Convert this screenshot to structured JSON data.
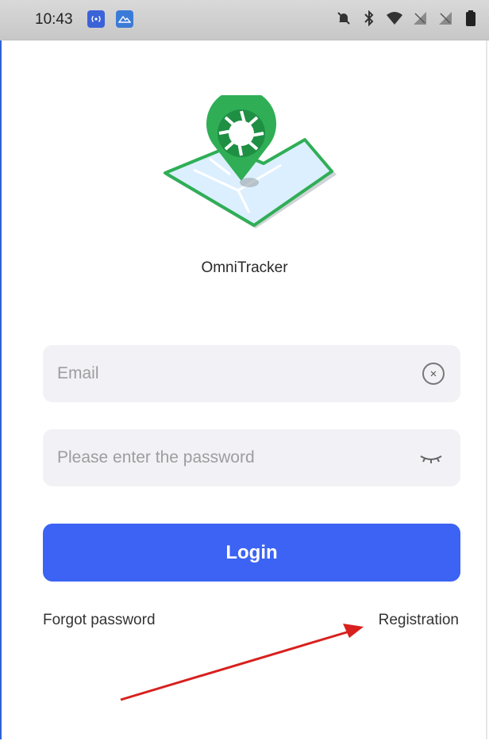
{
  "status_bar": {
    "time": "10:43"
  },
  "app": {
    "name": "OmniTracker"
  },
  "form": {
    "email_placeholder": "Email",
    "password_placeholder": "Please enter the password",
    "login_label": "Login"
  },
  "links": {
    "forgot_password": "Forgot password",
    "registration": "Registration"
  },
  "colors": {
    "primary": "#3c63f3",
    "logo_green": "#2fae56",
    "annotation_arrow": "#d8201e"
  },
  "icons": [
    "bell-off-icon",
    "bluetooth-icon",
    "wifi-icon",
    "signal-icon",
    "battery-icon",
    "clear-icon",
    "eye-closed-icon"
  ]
}
